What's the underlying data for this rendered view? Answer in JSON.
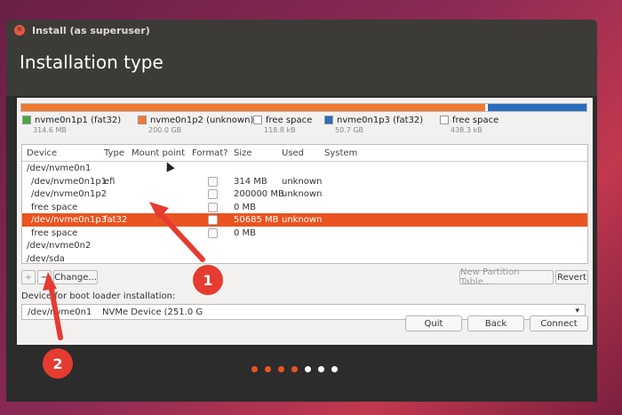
{
  "window": {
    "title": "Install (as superuser)",
    "close_icon": "close-icon"
  },
  "header": {
    "title": "Installation type"
  },
  "partition_bar": [
    {
      "color": "#ef7a2f",
      "fraction": 0.005
    },
    {
      "color": "#ef7a2f",
      "fraction": 0.815
    },
    {
      "color": "#ffffff",
      "fraction": 0.005
    },
    {
      "color": "#2a6ebb",
      "fraction": 0.175
    }
  ],
  "legend": [
    {
      "label": "nvme0n1p1 (fat32)",
      "size": "314.6 MB",
      "color": "#49a942"
    },
    {
      "label": "nvme0n1p2 (unknown)",
      "size": "200.0 GB",
      "color": "#ef7a2f"
    },
    {
      "label": "free space",
      "size": "118.8 kB",
      "color": "#ffffff"
    },
    {
      "label": "nvme0n1p3 (fat32)",
      "size": "50.7 GB",
      "color": "#2a6ebb"
    },
    {
      "label": "free space",
      "size": "438.3 kB",
      "color": "#ffffff"
    }
  ],
  "table": {
    "headers": [
      "Device",
      "Type",
      "Mount point",
      "Format?",
      "Size",
      "Used",
      "System"
    ],
    "rows": [
      {
        "device": "/dev/nvme0n1",
        "type": "",
        "mount": "",
        "format": false,
        "size": "",
        "used": "",
        "system": "",
        "selected": false,
        "checkbox": false
      },
      {
        "device": "/dev/nvme0n1p1",
        "type": "efi",
        "mount": "",
        "format": false,
        "size": "314 MB",
        "used": "unknown",
        "system": "",
        "selected": false,
        "checkbox": true
      },
      {
        "device": "/dev/nvme0n1p2",
        "type": "",
        "mount": "",
        "format": false,
        "size": "200000 MB",
        "used": "unknown",
        "system": "",
        "selected": false,
        "checkbox": true
      },
      {
        "device": "free space",
        "type": "",
        "mount": "",
        "format": false,
        "size": "0 MB",
        "used": "",
        "system": "",
        "selected": false,
        "checkbox": true
      },
      {
        "device": "/dev/nvme0n1p3",
        "type": "fat32",
        "mount": "",
        "format": false,
        "size": "50685 MB",
        "used": "unknown",
        "system": "",
        "selected": true,
        "checkbox": true
      },
      {
        "device": "free space",
        "type": "",
        "mount": "",
        "format": false,
        "size": "0 MB",
        "used": "",
        "system": "",
        "selected": false,
        "checkbox": true
      },
      {
        "device": "/dev/nvme0n2",
        "type": "",
        "mount": "",
        "format": false,
        "size": "",
        "used": "",
        "system": "",
        "selected": false,
        "checkbox": false
      },
      {
        "device": "/dev/sda",
        "type": "",
        "mount": "",
        "format": false,
        "size": "",
        "used": "",
        "system": "",
        "selected": false,
        "checkbox": false
      }
    ]
  },
  "toolbar": {
    "add_label": "+",
    "remove_label": "−",
    "change_label": "Change...",
    "new_table_label": "New Partition Table...",
    "revert_label": "Revert"
  },
  "bootloader": {
    "label": "Device for boot loader installation:",
    "selected_device": "/dev/nvme0n1",
    "selected_desc": "NVMe Device (251.0 G"
  },
  "nav": {
    "quit_label": "Quit",
    "back_label": "Back",
    "connect_label": "Connect"
  },
  "progress_dots": {
    "total": 7,
    "completed": 4,
    "active_color": "#e95420",
    "inactive_color": "#ffffff"
  },
  "annotations": [
    {
      "number": "1"
    },
    {
      "number": "2"
    }
  ]
}
